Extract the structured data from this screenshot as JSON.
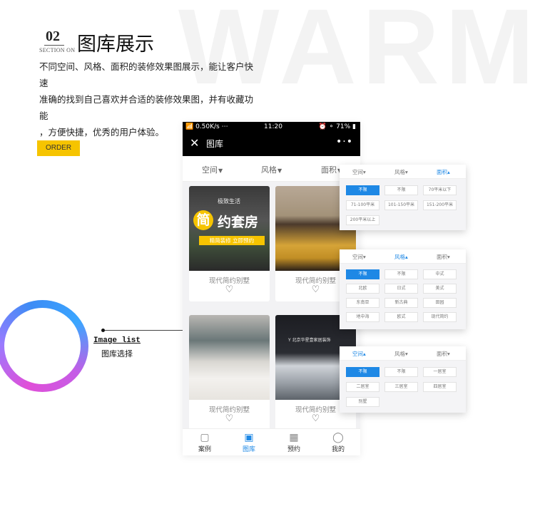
{
  "watermark": "WARM",
  "section": {
    "number": "02",
    "label": "SECTION ON",
    "title": "图库展示"
  },
  "description": [
    "不同空间、风格、面积的装修效果图展示，能让客户快速",
    "准确的找到自己喜欢并合适的装修效果图，并有收藏功能",
    "，方便快捷，优秀的用户体验。"
  ],
  "order_badge": "ORDER",
  "callout": {
    "en": "Image list",
    "cn": "图库选择"
  },
  "phone": {
    "status": {
      "left": "📶 0.50K/s ⋯",
      "time": "11:20",
      "right": "⏰ ⚬ 71% ▮"
    },
    "nav": {
      "close_icon": "✕",
      "title": "图库",
      "more_icon": "•·•"
    },
    "filters": [
      {
        "label": "空间",
        "caret": "▼"
      },
      {
        "label": "风格",
        "caret": "▼"
      },
      {
        "label": "面积",
        "caret": "▼"
      }
    ],
    "cards": [
      {
        "name": "现代简约别墅",
        "heart": "♡",
        "promo": {
          "sub": "极致生活",
          "mark": "简",
          "main": "约套房",
          "button": "精简装修 立即预约"
        }
      },
      {
        "name": "现代简约别墅",
        "heart": "♡"
      },
      {
        "name": "现代简约别墅",
        "heart": "♡"
      },
      {
        "name": "现代简约别墅",
        "heart": "♡",
        "tag": "Y 北京华星壹家居装饰"
      }
    ],
    "tabs": [
      {
        "label": "案例",
        "icon": "▢",
        "icon_name": "folder-icon",
        "active": false
      },
      {
        "label": "图库",
        "icon": "▣",
        "icon_name": "image-icon",
        "active": true
      },
      {
        "label": "预约",
        "icon": "▦",
        "icon_name": "calendar-icon",
        "active": false
      },
      {
        "label": "我的",
        "icon": "◯",
        "icon_name": "user-icon",
        "active": false
      }
    ]
  },
  "panels": [
    {
      "tabs": [
        {
          "label": "空间▾"
        },
        {
          "label": "风格▾"
        },
        {
          "label": "面积▴"
        }
      ],
      "active_tab": 2,
      "options": [
        "不限",
        "不限",
        "70平米以下",
        "71-100平米",
        "101-150平米",
        "151-200平米",
        "200平米以上"
      ]
    },
    {
      "tabs": [
        {
          "label": "空间▾"
        },
        {
          "label": "风格▴"
        },
        {
          "label": "面积▾"
        }
      ],
      "active_tab": 1,
      "options": [
        "不限",
        "不限",
        "中式",
        "北欧",
        "日式",
        "美式",
        "东南亚",
        "新古典",
        "田园",
        "地中海",
        "欧式",
        "现代简约"
      ]
    },
    {
      "tabs": [
        {
          "label": "空间▴"
        },
        {
          "label": "风格▾"
        },
        {
          "label": "面积▾"
        }
      ],
      "active_tab": 0,
      "options": [
        "不限",
        "不限",
        "一居室",
        "二居室",
        "三居室",
        "四居室",
        "别墅"
      ]
    }
  ],
  "colors": {
    "accent": "#1e88e5",
    "badge": "#f6c400"
  }
}
